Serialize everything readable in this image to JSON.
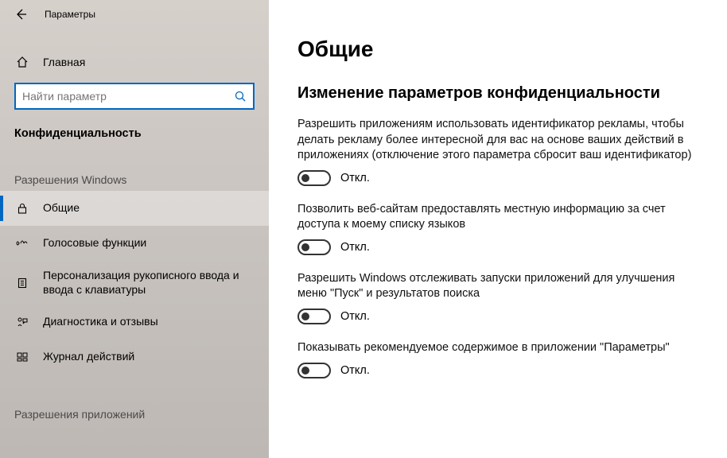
{
  "window": {
    "title": "Параметры"
  },
  "sidebar": {
    "home": "Главная",
    "search_placeholder": "Найти параметр",
    "section": "Конфиденциальность",
    "group1": "Разрешения Windows",
    "items": [
      {
        "label": "Общие"
      },
      {
        "label": "Голосовые функции"
      },
      {
        "label": "Персонализация рукописного ввода и ввода с клавиатуры"
      },
      {
        "label": "Диагностика и отзывы"
      },
      {
        "label": "Журнал действий"
      }
    ],
    "group2": "Разрешения приложений"
  },
  "main": {
    "title": "Общие",
    "subtitle": "Изменение параметров конфиденциальности",
    "settings": [
      {
        "desc": "Разрешить приложениям использовать идентификатор рекламы, чтобы делать рекламу более интересной для вас на основе ваших действий в приложениях (отключение этого параметра сбросит ваш идентификатор)",
        "state": "Откл."
      },
      {
        "desc": "Позволить веб-сайтам предоставлять местную информацию за счет доступа к моему списку языков",
        "state": "Откл."
      },
      {
        "desc": "Разрешить Windows отслеживать запуски приложений для улучшения меню \"Пуск\" и результатов поиска",
        "state": "Откл."
      },
      {
        "desc": "Показывать рекомендуемое содержимое в приложении \"Параметры\"",
        "state": "Откл."
      }
    ]
  }
}
